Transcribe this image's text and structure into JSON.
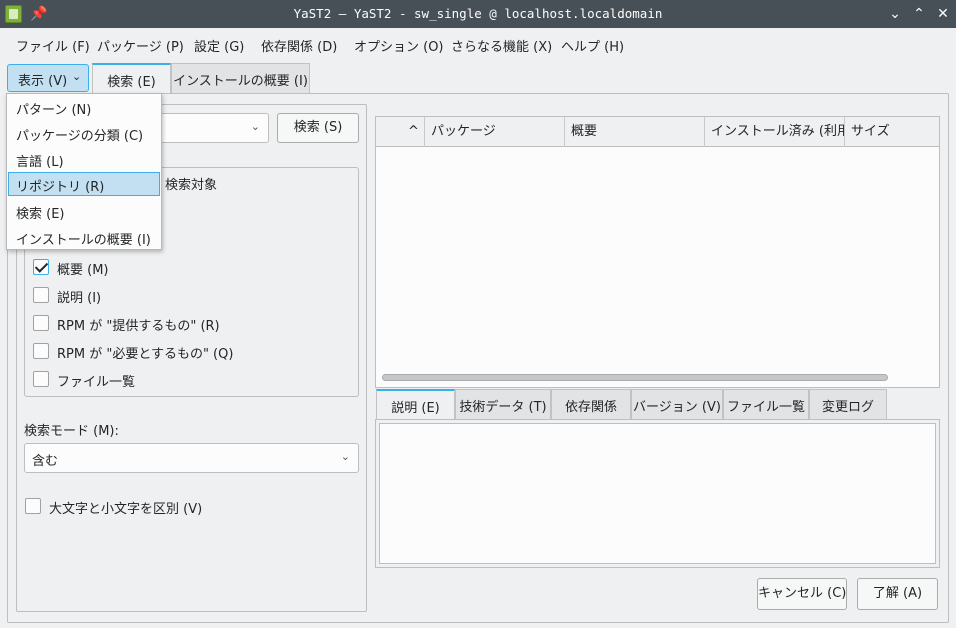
{
  "window": {
    "title": "YaST2 — YaST2 - sw_single @ localhost.localdomain",
    "pin_glyph": "📌",
    "minimize_glyph": "⌄",
    "maximize_glyph": "⌃",
    "close_glyph": "✕"
  },
  "menubar": {
    "items": [
      "ファイル (F)",
      "パッケージ (P)",
      "設定 (G)",
      "依存関係 (D)",
      "オプション (O)",
      "さらなる機能 (X)",
      "ヘルプ (H)"
    ]
  },
  "view_button": {
    "label": "表示 (V)",
    "chevron": "⌄"
  },
  "tabs": [
    "検索 (E)",
    "インストールの概要 (I)"
  ],
  "view_menu": {
    "items": [
      "パターン (N)",
      "パッケージの分類 (C)",
      "言語 (L)",
      "リポジトリ (R)",
      "検索 (E)",
      "インストールの概要 (I)"
    ],
    "highlighted_index": 3
  },
  "search": {
    "query": "",
    "chevron": "⌄",
    "button_label": "検索 (S)",
    "group_title": "検索対象",
    "fields": [
      {
        "label": "概要 (M)",
        "checked": true
      },
      {
        "label": "説明 (I)",
        "checked": false
      },
      {
        "label": "RPM が \"提供するもの\" (R)",
        "checked": false
      },
      {
        "label": "RPM が \"必要とするもの\" (Q)",
        "checked": false
      },
      {
        "label": "ファイル一覧",
        "checked": false
      }
    ],
    "mode_label": "検索モード (M):",
    "mode_value": "含む",
    "case_label": "大文字と小文字を区別 (V)",
    "case_checked": false
  },
  "package_table": {
    "sort_glyph": "^",
    "columns": [
      "パッケージ",
      "概要",
      "インストール済み (利用可",
      "サイズ"
    ]
  },
  "detail_tabs": [
    "説明 (E)",
    "技術データ (T)",
    "依存関係",
    "バージョン (V)",
    "ファイル一覧",
    "変更ログ"
  ],
  "footer": {
    "cancel_label": "キャンセル (C)",
    "ok_label": "了解 (A)"
  },
  "colors": {
    "accent": "#3daee9",
    "highlight": "#c3e0f2",
    "titlebar": "#475057"
  }
}
